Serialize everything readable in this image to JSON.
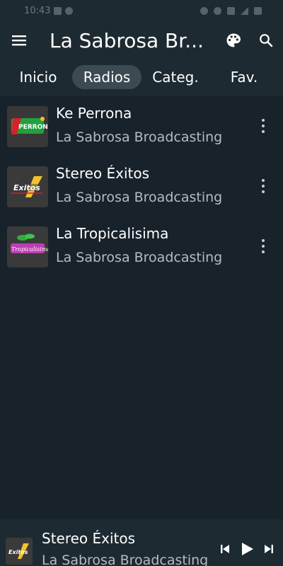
{
  "status_bar": {
    "time": "10:43"
  },
  "app_bar": {
    "title": "La Sabrosa Br...",
    "menu_icon": "menu-icon",
    "palette_icon": "palette-icon",
    "search_icon": "search-icon"
  },
  "tabs": [
    {
      "label": "Inicio",
      "active": false
    },
    {
      "label": "Radios",
      "active": true
    },
    {
      "label": "Categ.",
      "active": false
    },
    {
      "label": "Fav.",
      "active": false
    }
  ],
  "stations": [
    {
      "name": "Ke Perrona",
      "owner": "La Sabrosa Broadcasting",
      "logo_text": "PERRONA",
      "accent": "#d4232b"
    },
    {
      "name": "Stereo Éxitos",
      "owner": "La Sabrosa Broadcasting",
      "logo_text": "Exitos",
      "accent": "#f2c230"
    },
    {
      "name": "La Tropicalisima",
      "owner": "La Sabrosa Broadcasting",
      "logo_text": "Tropicalisima",
      "accent": "#d63ec9"
    }
  ],
  "player": {
    "title": "Stereo Éxitos",
    "subtitle": "La Sabrosa Broadcasting",
    "logo_text": "Exitos"
  },
  "colors": {
    "background": "#18222a",
    "bar": "#1e2a31",
    "active_tab": "#3c4a52",
    "secondary_text": "#b4bcc2"
  }
}
